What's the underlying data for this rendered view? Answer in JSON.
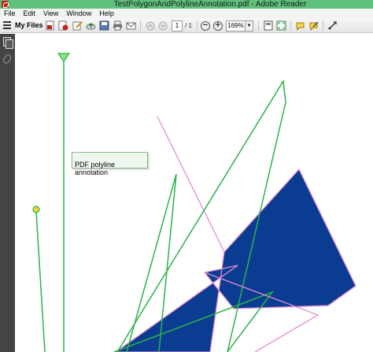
{
  "window": {
    "title": "TestPolygonAndPolylineAnnotation.pdf - Adobe Reader"
  },
  "menu": {
    "items": [
      "File",
      "Edit",
      "View",
      "Window",
      "Help"
    ]
  },
  "toolbar": {
    "my_files_label": "My Files",
    "page_current": "1",
    "page_total": "/ 1",
    "zoom_value": "169%",
    "zoom_dropdown_glyph": "▼",
    "zoom_out_glyph": "−",
    "zoom_in_glyph": "+"
  },
  "annotation_tooltip": {
    "text": "PDF polyline annotation"
  },
  "colors": {
    "title_bar": "#5ec07c",
    "polyline_stroke": "#2bb24a",
    "polygon_fill": "#0a3d91",
    "polygon_stroke": "#e58bd6",
    "left_panel": "#444444"
  },
  "icons": {
    "app": "adobe-reader-icon",
    "left_panel": [
      "pages-icon",
      "attachment-icon"
    ],
    "toolbar": [
      "create-pdf-icon",
      "export-pdf-icon",
      "edit-icon",
      "cloud-upload-icon",
      "save-icon",
      "print-icon",
      "email-icon",
      "prev-page-icon",
      "next-page-icon",
      "zoom-out-icon",
      "zoom-in-icon",
      "fit-page-icon",
      "fullscreen-icon",
      "comment-icon",
      "sign-icon",
      "tools-icon"
    ]
  }
}
